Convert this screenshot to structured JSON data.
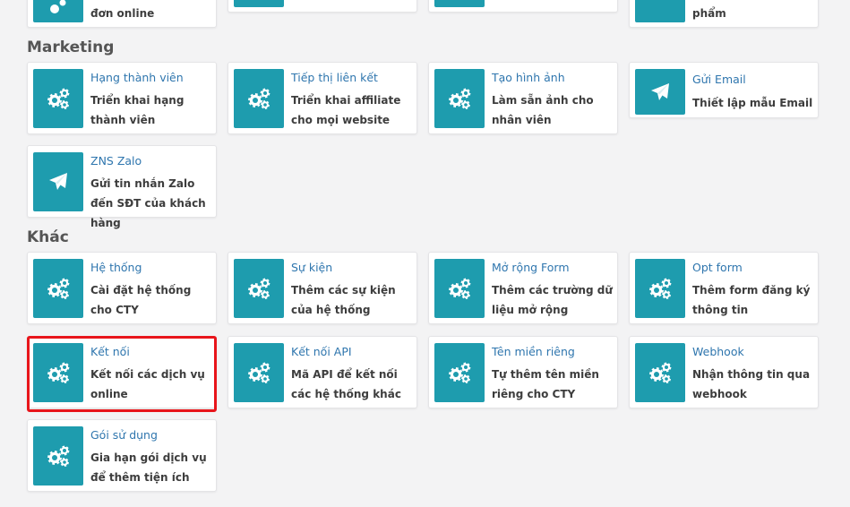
{
  "top_row": [
    {
      "title": "",
      "desc": "đơn online",
      "icon": "gears-icon"
    },
    {
      "title": "",
      "desc": "",
      "icon": "gears-icon"
    },
    {
      "title": "",
      "desc": "",
      "icon": "gears-icon"
    },
    {
      "title": "",
      "desc": "phẩm",
      "icon": "gears-icon"
    }
  ],
  "sections": {
    "marketing": {
      "title": "Marketing",
      "cards": [
        {
          "title": "Hạng thành viên",
          "desc": "Triển khai hạng thành viên",
          "icon": "gears-icon"
        },
        {
          "title": "Tiếp thị liên kết",
          "desc": "Triển khai affiliate cho mọi website",
          "icon": "gears-icon"
        },
        {
          "title": "Tạo hình ảnh",
          "desc": "Làm sẵn ảnh cho nhân viên",
          "icon": "gears-icon"
        },
        {
          "title": "Gửi Email",
          "desc": "Thiết lập mẫu Email",
          "icon": "paper-plane-icon"
        },
        {
          "title": "ZNS Zalo",
          "desc": "Gửi tin nhắn Zalo đến SĐT của khách hàng",
          "icon": "paper-plane-icon"
        }
      ]
    },
    "other": {
      "title": "Khác",
      "cards": [
        {
          "title": "Hệ thống",
          "desc": "Cài đặt hệ thống cho CTY",
          "icon": "gears-icon"
        },
        {
          "title": "Sự kiện",
          "desc": "Thêm các sự kiện của hệ thống",
          "icon": "gears-icon"
        },
        {
          "title": "Mở rộng Form",
          "desc": "Thêm các trường dữ liệu mở rộng",
          "icon": "gears-icon"
        },
        {
          "title": "Opt form",
          "desc": "Thêm form đăng ký thông tin",
          "icon": "gears-icon"
        },
        {
          "title": "Kết nối",
          "desc": "Kết nối các dịch vụ online",
          "icon": "gears-icon"
        },
        {
          "title": "Kết nối API",
          "desc": "Mã API để kết nối các hệ thống khác",
          "icon": "gears-icon"
        },
        {
          "title": "Tên miền riêng",
          "desc": "Tự thêm tên miền riêng cho CTY",
          "icon": "gears-icon"
        },
        {
          "title": "Webhook",
          "desc": "Nhận thông tin qua webhook",
          "icon": "gears-icon"
        },
        {
          "title": "Gói sử dụng",
          "desc": "Gia hạn gói dịch vụ để thêm tiện ích",
          "icon": "gears-icon"
        }
      ]
    }
  },
  "colors": {
    "accent": "#1e9cae",
    "link": "#2f76ae",
    "highlight": "#e8151b",
    "background": "#f3f3f4"
  }
}
